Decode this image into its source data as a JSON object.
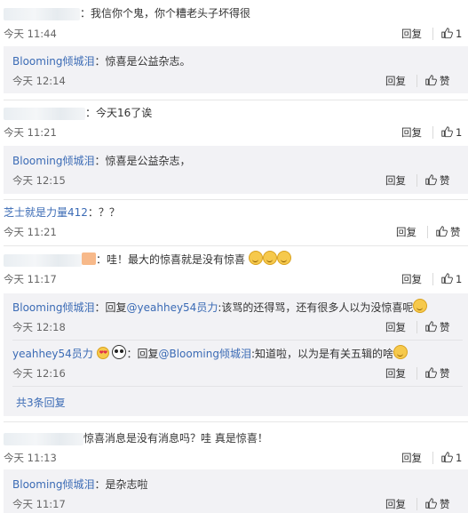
{
  "actions": {
    "reply": "回复",
    "reply_alt": "回复",
    "like_word": "赞"
  },
  "comments": [
    {
      "text": "：我信你个鬼，你个糟老头子坏得很",
      "time": "今天 11:44",
      "likes": "1"
    },
    {
      "text": "：今天16了诶",
      "time": "今天 11:21",
      "likes": "1"
    },
    {
      "user": "芝士就是力量412",
      "text": "：？？",
      "time": "今天 11:21"
    },
    {
      "text": "：哇！最大的惊喜就是没有惊喜",
      "time": "今天 11:17",
      "likes": "1"
    },
    {
      "text": "惊喜消息是没有消息吗？哇 真是惊喜！",
      "time": "今天 11:13",
      "likes": "1"
    }
  ],
  "replies": [
    {
      "user": "Blooming倾城泪",
      "text": "：惊喜是公益杂志。",
      "time": "今天 12:14"
    },
    {
      "user": "Blooming倾城泪",
      "text": "：惊喜是公益杂志，",
      "time": "今天 12:15"
    },
    {
      "user": "Blooming倾城泪",
      "text_prefix": "：回复",
      "mention": "@yeahhey54员力",
      "text": ":该骂的还得骂，还有很多人以为没惊喜呢",
      "time": "今天 12:18"
    },
    {
      "user": "yeahhey54员力",
      "text_prefix": "：回复",
      "mention": "@Blooming倾城泪",
      "text": ":知道啦，以为是有关五辑的啥",
      "time": "今天 12:16"
    },
    {
      "user": "Blooming倾城泪",
      "text": "：是杂志啦",
      "time": "今天 11:17"
    }
  ],
  "expand_label": "共3条回复"
}
